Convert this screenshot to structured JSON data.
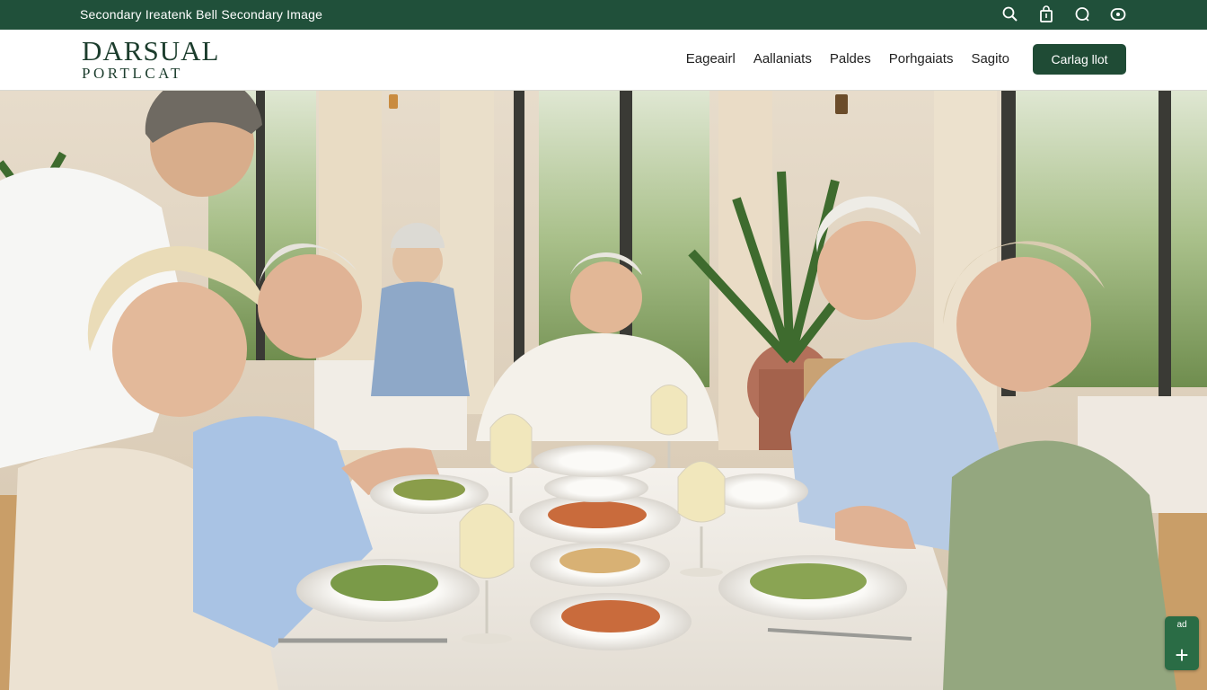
{
  "topbar": {
    "text": "Secondary Ireatenk Bell Secondary Image",
    "icons": [
      "search-icon",
      "bag-icon",
      "chat-icon",
      "account-icon"
    ]
  },
  "header": {
    "logo_main": "DARSUAL",
    "logo_sub": "PORTLCAT",
    "nav": [
      "Eageairl",
      "Aallaniats",
      "Paldes",
      "Porhgaiats",
      "Sagito"
    ],
    "cta_label": "Carlag llot"
  },
  "hero": {
    "alt": "Older couples dining together at a restaurant table with wine glasses and plated vegetable dishes"
  },
  "widget": {
    "label": "ad",
    "plus": "+"
  },
  "colors": {
    "brand_green": "#20503a",
    "cta_green": "#1f4b35",
    "widget_green": "#2a6c45"
  }
}
